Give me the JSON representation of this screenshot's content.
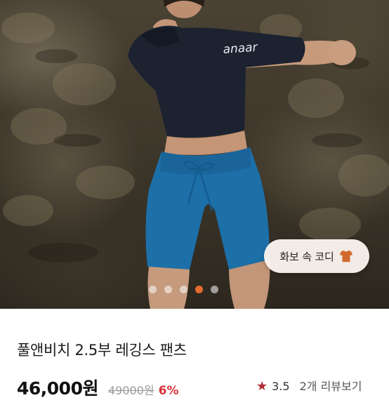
{
  "product": {
    "title": "풀앤비치 2.5부 레깅스 팬츠",
    "price": "46,000원",
    "original_price": "49000원",
    "discount": "6%",
    "rating": "3.5",
    "review_link": "2개 리뷰보기"
  },
  "gallery": {
    "coordi_label": "화보 속 코디",
    "coordi_icon": "tshirt-icon",
    "slide_count": 5,
    "active_index": 3,
    "shirt_print": "anaar"
  },
  "colors": {
    "accent": "#e46b2c",
    "discount": "#d8323a",
    "star": "#b02a33",
    "shorts": "#1d6fa8",
    "top": "#1c2230"
  }
}
